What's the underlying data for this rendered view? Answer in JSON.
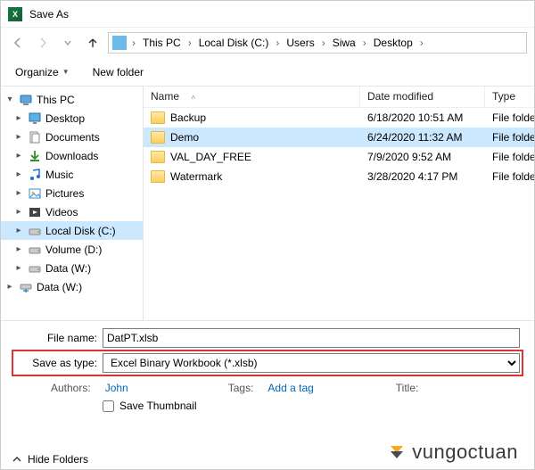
{
  "window": {
    "title": "Save As"
  },
  "breadcrumb": [
    "This PC",
    "Local Disk (C:)",
    "Users",
    "Siwa",
    "Desktop"
  ],
  "toolbar": {
    "organize": "Organize",
    "newfolder": "New folder"
  },
  "tree": [
    {
      "label": "This PC",
      "icon": "pc",
      "caret": "open",
      "indent": 0,
      "selected": false
    },
    {
      "label": "Desktop",
      "icon": "desktop",
      "caret": "closed",
      "indent": 1
    },
    {
      "label": "Documents",
      "icon": "documents",
      "caret": "closed",
      "indent": 1
    },
    {
      "label": "Downloads",
      "icon": "downloads",
      "caret": "closed",
      "indent": 1
    },
    {
      "label": "Music",
      "icon": "music",
      "caret": "closed",
      "indent": 1
    },
    {
      "label": "Pictures",
      "icon": "pictures",
      "caret": "closed",
      "indent": 1
    },
    {
      "label": "Videos",
      "icon": "videos",
      "caret": "closed",
      "indent": 1
    },
    {
      "label": "Local Disk (C:)",
      "icon": "drive",
      "caret": "closed",
      "indent": 1,
      "selected": true
    },
    {
      "label": "Volume (D:)",
      "icon": "drive",
      "caret": "closed",
      "indent": 1
    },
    {
      "label": "Data (W:)",
      "icon": "drive",
      "caret": "closed",
      "indent": 1
    },
    {
      "label": "Data (W:)",
      "icon": "netdrive",
      "caret": "closed",
      "indent": 0
    }
  ],
  "columns": {
    "name": "Name",
    "date": "Date modified",
    "type": "Type"
  },
  "files": [
    {
      "name": "Backup",
      "date": "6/18/2020 10:51 AM",
      "type": "File folder",
      "selected": false
    },
    {
      "name": "Demo",
      "date": "6/24/2020 11:32 AM",
      "type": "File folder",
      "selected": true
    },
    {
      "name": "VAL_DAY_FREE",
      "date": "7/9/2020 9:52 AM",
      "type": "File folder",
      "selected": false
    },
    {
      "name": "Watermark",
      "date": "3/28/2020 4:17 PM",
      "type": "File folder",
      "selected": false
    }
  ],
  "form": {
    "filename_label": "File name:",
    "filename_value": "DatPT.xlsb",
    "savetype_label": "Save as type:",
    "savetype_value": "Excel Binary Workbook (*.xlsb)",
    "authors_label": "Authors:",
    "authors_value": "John",
    "tags_label": "Tags:",
    "tags_value": "Add a tag",
    "title_label": "Title:",
    "savethumb": "Save Thumbnail"
  },
  "footer": {
    "hidefolders": "Hide Folders"
  },
  "watermark": {
    "text": "vungoctuan"
  }
}
